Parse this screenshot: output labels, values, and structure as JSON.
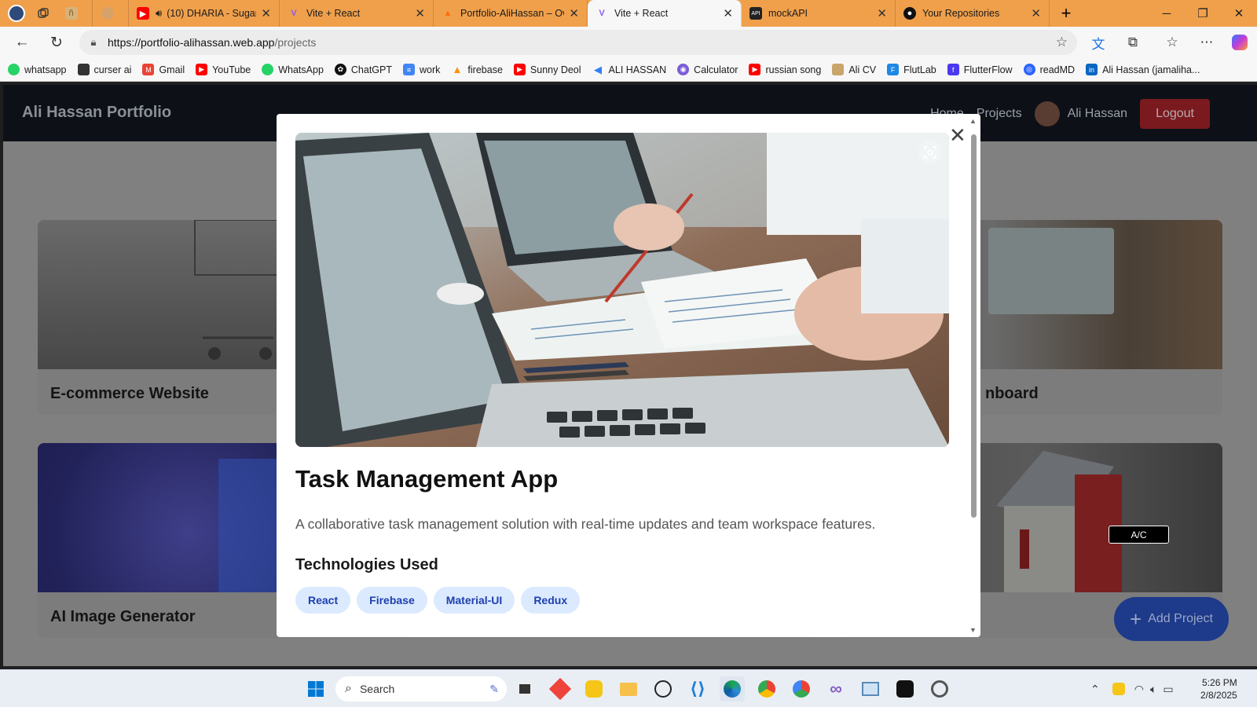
{
  "browser": {
    "tabs": [
      {
        "title": "(10) DHARIA - Sugar",
        "favicon": "youtube-icon",
        "muted_icon": "speaker-icon"
      },
      {
        "title": "Vite + React",
        "favicon": "vite-icon"
      },
      {
        "title": "Portfolio-AliHassan – Over",
        "favicon": "firebase-icon"
      },
      {
        "title": "Vite + React",
        "favicon": "vite-icon",
        "active": true
      },
      {
        "title": "mockAPI",
        "favicon": "mockapi-icon"
      },
      {
        "title": "Your Repositories",
        "favicon": "github-icon"
      }
    ],
    "new_tab": "+",
    "url_host": "https://portfolio-alihassan.web.app",
    "url_path": "/projects",
    "bookmarks": [
      {
        "label": "whatsapp",
        "color": "#25d366"
      },
      {
        "label": "curser ai",
        "color": "#222222"
      },
      {
        "label": "Gmail",
        "color": "#ea4335"
      },
      {
        "label": "YouTube",
        "color": "#ff0000"
      },
      {
        "label": "WhatsApp",
        "color": "#25d366"
      },
      {
        "label": "ChatGPT",
        "color": "#111111"
      },
      {
        "label": "work",
        "color": "#4285f4"
      },
      {
        "label": "firebase",
        "color": "#ff8f00"
      },
      {
        "label": "Sunny Deol",
        "color": "#ff0000"
      },
      {
        "label": "ALI HASSAN",
        "color": "#2d7ff9"
      },
      {
        "label": "Calculator",
        "color": "#7b5cd6"
      },
      {
        "label": "russian song",
        "color": "#ff0000"
      },
      {
        "label": "Ali CV",
        "color": "#c9a46b"
      },
      {
        "label": "FlutLab",
        "color": "#1e88e5"
      },
      {
        "label": "FlutterFlow",
        "color": "#4b39ef"
      },
      {
        "label": "readMD",
        "color": "#2962ff"
      },
      {
        "label": "Ali Hassan (jamaliha...",
        "color": "#0a66c2"
      }
    ]
  },
  "app": {
    "brand": "Ali Hassan Portfolio",
    "nav": {
      "home": "Home",
      "projects": "Projects",
      "user": "Ali Hassan",
      "logout": "Logout"
    },
    "cards": [
      {
        "title": "E-commerce Website"
      },
      {
        "title": "nboard"
      },
      {
        "title": "AI Image Generator"
      }
    ],
    "add_project": "Add Project",
    "overlay_badge": "A/C"
  },
  "modal": {
    "title": "Task Management App",
    "description": "A collaborative task management solution with real-time updates and team workspace features.",
    "tech_heading": "Technologies Used",
    "technologies": [
      "React",
      "Firebase",
      "Material-UI",
      "Redux"
    ]
  },
  "taskbar": {
    "search_placeholder": "Search",
    "time": "5:26 PM",
    "date": "2/8/2025"
  },
  "colors": {
    "tabbar": "#f0a04b",
    "appnav": "#0d1117",
    "logout": "#7a1a1f",
    "chip_bg": "#dbeafe",
    "chip_text": "#1e40af",
    "add_button": "#1e3a8a"
  }
}
